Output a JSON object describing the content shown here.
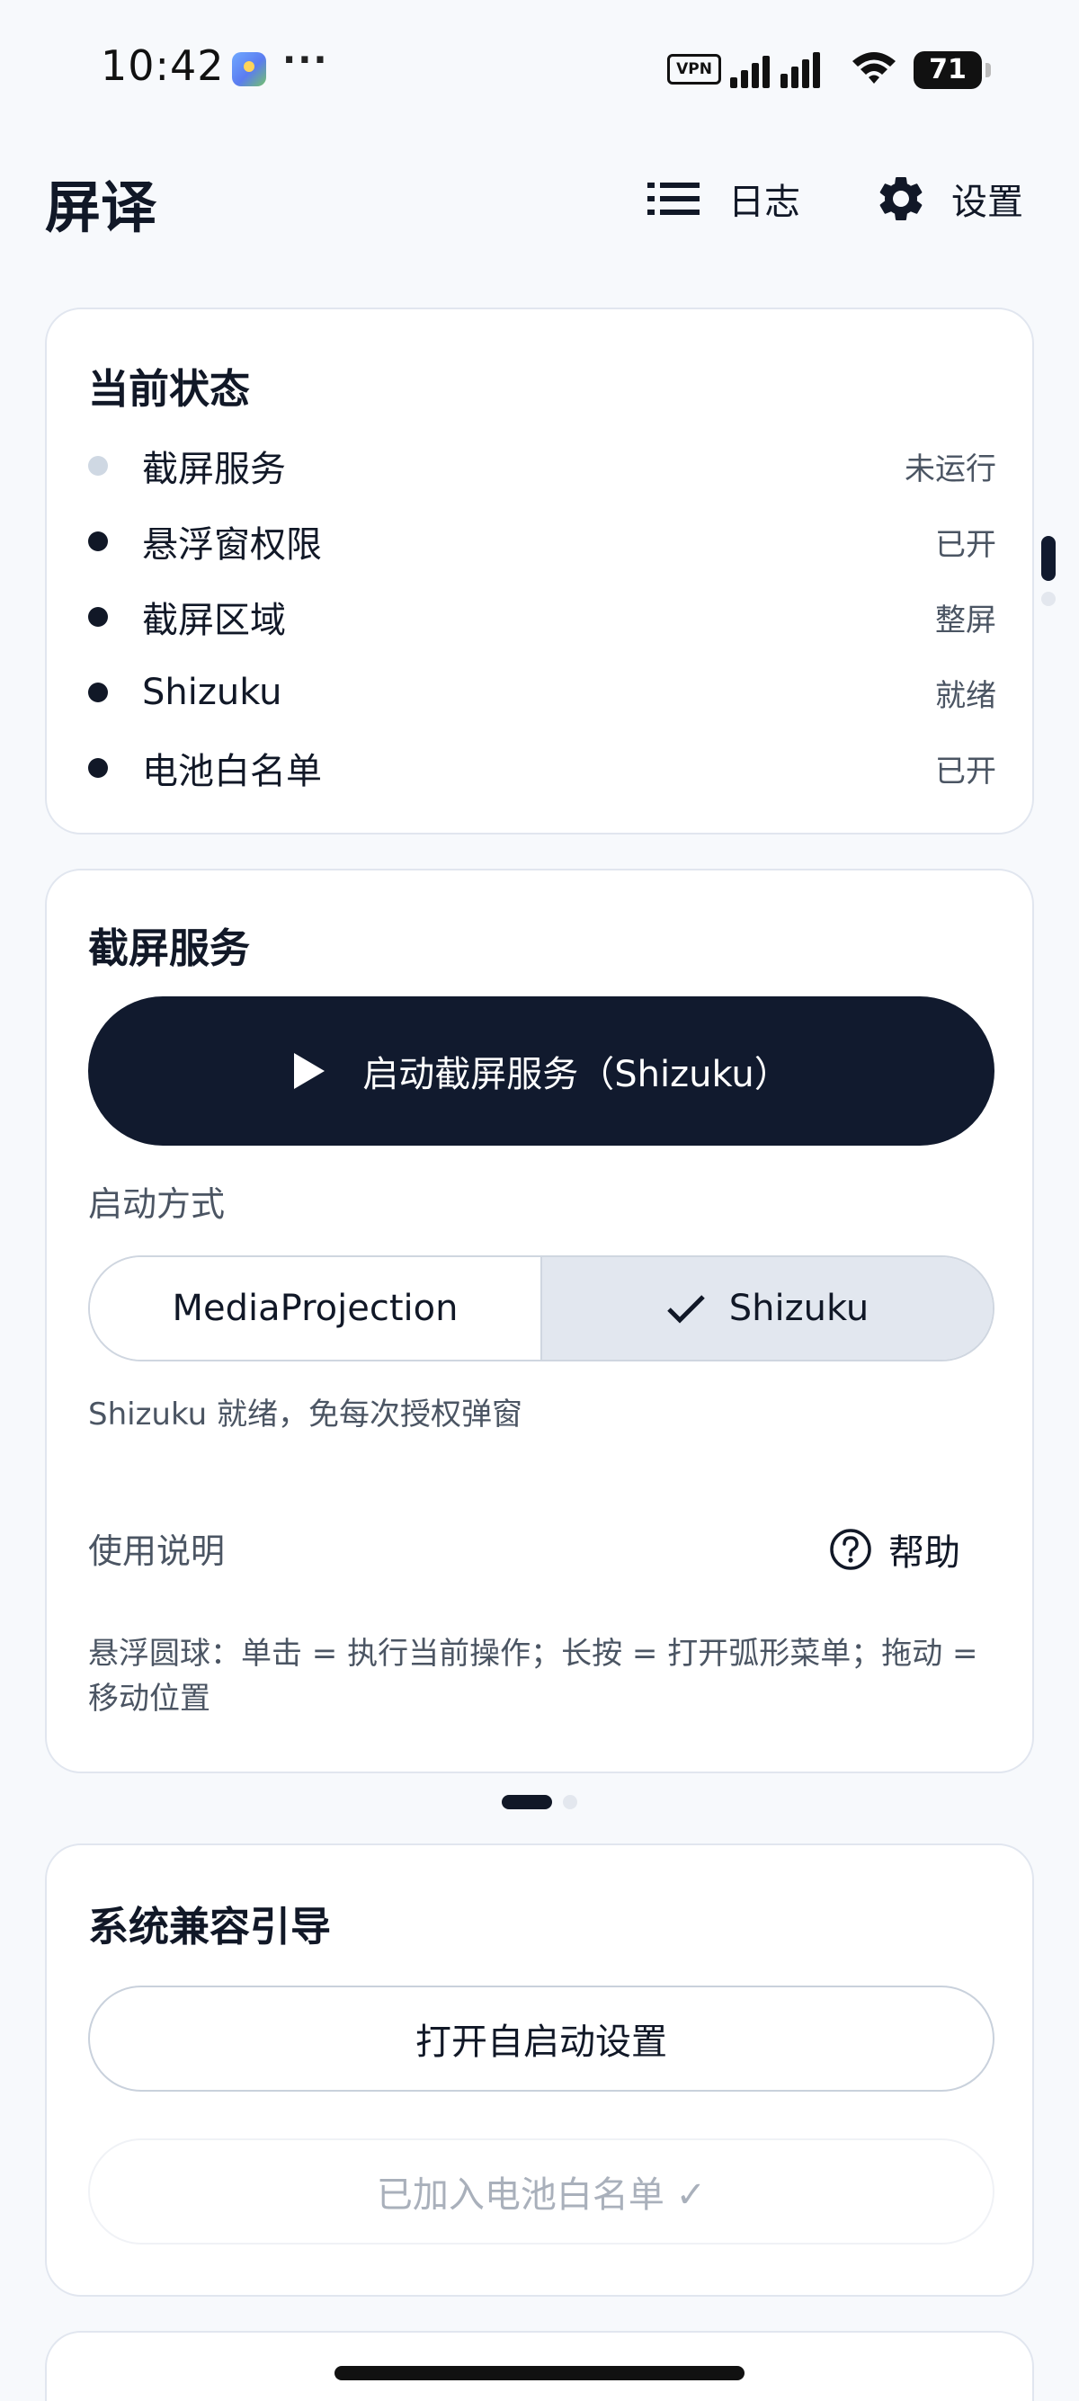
{
  "status_bar": {
    "time": "10:42",
    "more": "···",
    "vpn": "VPN",
    "battery": "71",
    "icons": [
      "photo-app-icon",
      "vpn-icon",
      "cellular-signal-icon",
      "wifi-icon",
      "battery-icon"
    ]
  },
  "app_bar": {
    "title": "屏译",
    "log_label": "日志",
    "settings_label": "设置"
  },
  "current_status": {
    "title": "当前状态",
    "rows": [
      {
        "label": "截屏服务",
        "value": "未运行",
        "active": false
      },
      {
        "label": "悬浮窗权限",
        "value": "已开",
        "active": true
      },
      {
        "label": "截屏区域",
        "value": "整屏",
        "active": true
      },
      {
        "label": "Shizuku",
        "value": "就绪",
        "active": true
      },
      {
        "label": "电池白名单",
        "value": "已开",
        "active": true
      }
    ]
  },
  "capture_service": {
    "title": "截屏服务",
    "start_button": "启动截屏服务（Shizuku）",
    "mode_label": "启动方式",
    "mode_options": [
      "MediaProjection",
      "Shizuku"
    ],
    "selected_mode": "Shizuku",
    "mode_hint": "Shizuku 就绪，免每次授权弹窗",
    "usage_label": "使用说明",
    "help_label": "帮助",
    "usage_text": "悬浮圆球：单击 = 执行当前操作；长按 = 打开弧形菜单；拖动 = 移动位置"
  },
  "compat_guide": {
    "title": "系统兼容引导",
    "autostart_button": "打开自启动设置",
    "battery_button": "已加入电池白名单 ✓"
  },
  "colors": {
    "primary": "#111a2e",
    "background": "#f7f9fc",
    "card_border": "#e1e6ef",
    "selected_segment": "#e2e7ef",
    "inactive_dot": "#cfd8e3"
  }
}
